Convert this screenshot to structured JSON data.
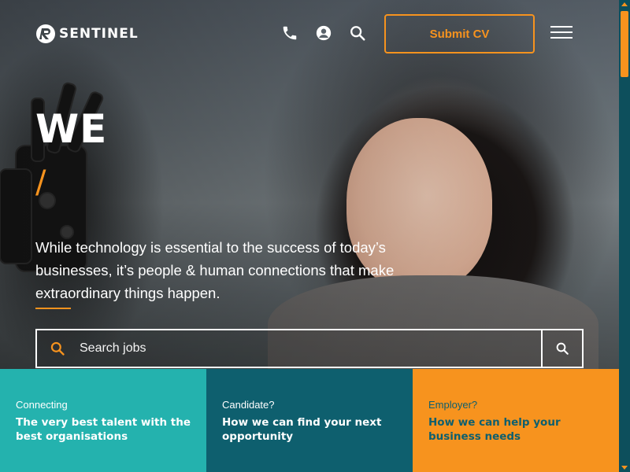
{
  "brand": {
    "name": "SENTINEL"
  },
  "header": {
    "icons": [
      "phone-icon",
      "account-icon",
      "search-icon"
    ],
    "submit_cv_label": "Submit CV",
    "menu_icon": "hamburger-menu-icon"
  },
  "hero": {
    "headline": "WE",
    "slash": "/",
    "lead": "While technology is essential to the success of today’s businesses, it’s people & human connections that make extraordinary things happen."
  },
  "search": {
    "placeholder": "Search jobs",
    "value": ""
  },
  "cards": [
    {
      "kicker": "Connecting",
      "title": "The very best talent with the best organisations"
    },
    {
      "kicker": "Candidate?",
      "title": "How we can find your next opportunity"
    },
    {
      "kicker": "Employer?",
      "title": "How we can help your business needs"
    }
  ],
  "colors": {
    "accent": "#f7931e",
    "teal": "#24b2ae",
    "dark_teal": "#0e5f6e"
  }
}
